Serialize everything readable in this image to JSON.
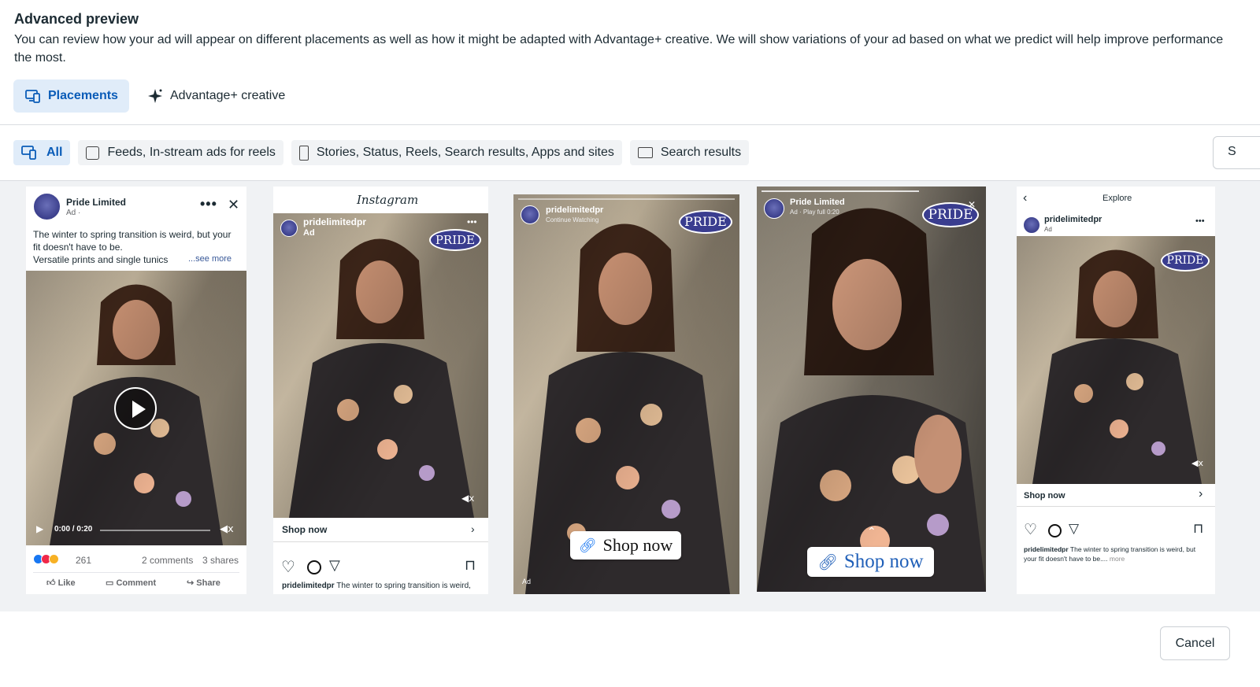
{
  "header": {
    "title": "Advanced preview",
    "description": "You can review how your ad will appear on different placements as well as how it might be adapted with Advantage+ creative. We will show variations of your ad based on what we predict will help improve performance the most."
  },
  "tabs": [
    {
      "label": "Placements",
      "icon": "placements-icon",
      "active": true
    },
    {
      "label": "Advantage+ creative",
      "icon": "sparkle-icon",
      "active": false
    }
  ],
  "filters": [
    {
      "label": "All",
      "active": true
    },
    {
      "label": "Feeds, In-stream ads for reels",
      "active": false
    },
    {
      "label": "Stories, Status, Reels, Search results, Apps and sites",
      "active": false
    },
    {
      "label": "Search results",
      "active": false
    }
  ],
  "side_button_label": "S",
  "fb_feed": {
    "page_name": "Pride Limited",
    "sponsored": "Ad · ",
    "text_line1": "The winter to spring transition is weird, but your",
    "text_line2": "fit doesn't have to be.",
    "text_line3": "Versatile prints and single tunics",
    "see_more": "...see more",
    "time": "0:00 / 0:20",
    "reactions_count": "261",
    "comments": "2 comments",
    "shares": "3 shares",
    "like": "Like",
    "comment": "Comment",
    "share": "Share"
  },
  "ig_feed": {
    "logo": "Instagram",
    "handle": "pridelimitedpr",
    "sponsored": "Ad",
    "cta": "Shop now",
    "caption_handle": "pridelimitedpr",
    "caption": "The winter to spring transition is weird,"
  },
  "ig_story": {
    "handle": "pridelimitedpr",
    "subtitle": "Continue Watching",
    "cta": "Shop now",
    "ad_label": "Ad"
  },
  "fb_story": {
    "page_name": "Pride Limited",
    "subtitle": "Ad · Play full 0:20",
    "cta": "Shop now"
  },
  "ig_explore": {
    "title": "Explore",
    "handle": "pridelimitedpr",
    "sponsored": "Ad",
    "cta": "Shop now",
    "caption_handle": "pridelimitedpr",
    "caption": "The winter to spring transition is weird, but your fit doesn't have to be....",
    "more": "more"
  },
  "brand_logo": "PRIDE",
  "cancel_label": "Cancel",
  "colors": {
    "accent": "#0a5cb8",
    "active_bg": "#e0ecf9",
    "dress": "#2e2a2c",
    "brand_badge": "#3a3d8f"
  }
}
